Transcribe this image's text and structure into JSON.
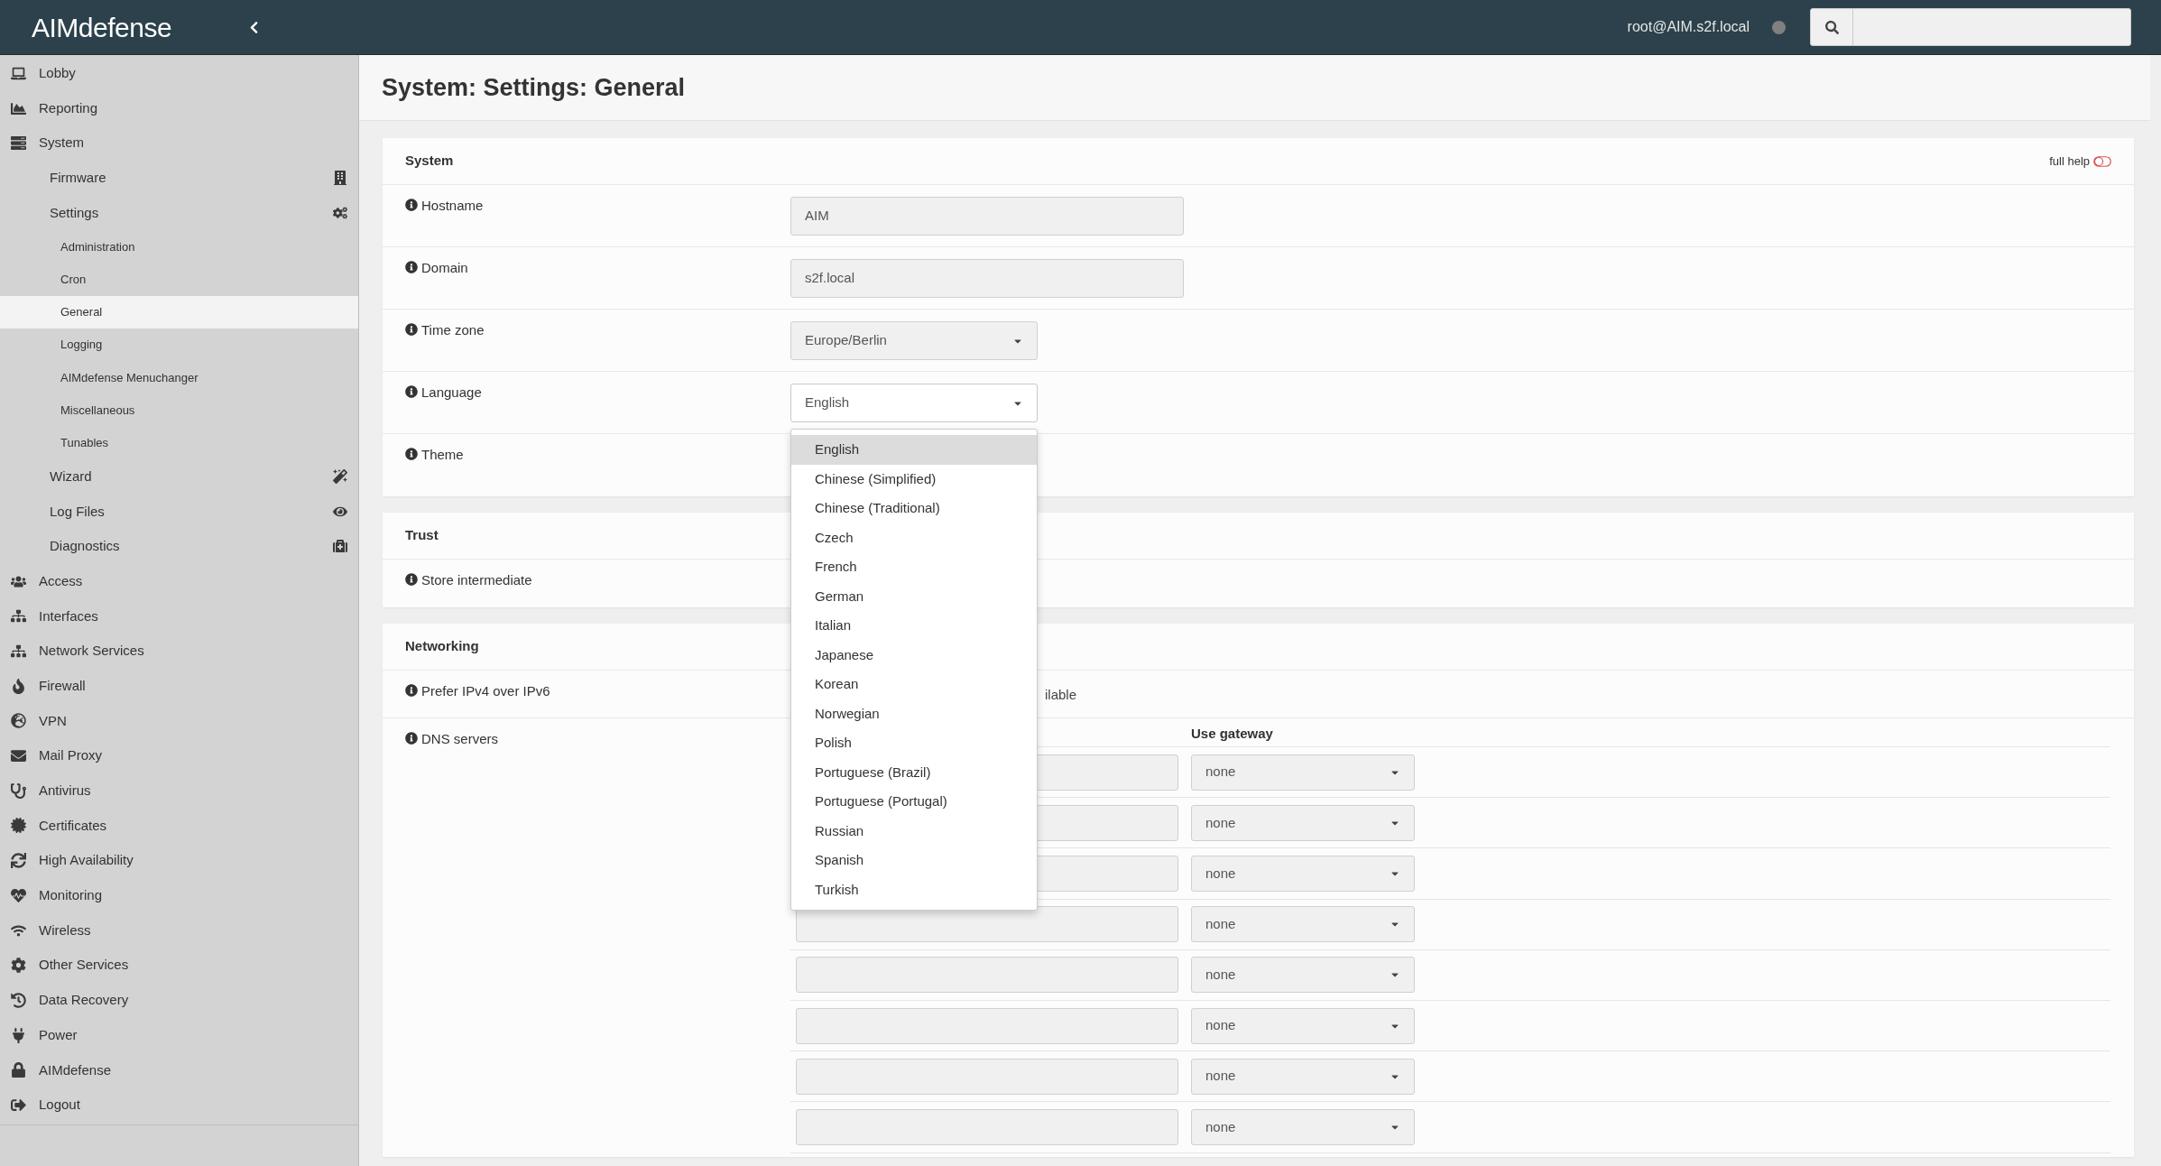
{
  "topbar": {
    "logo": "AIMdefense",
    "user": "root@AIM.s2f.local"
  },
  "sidebar": {
    "items": [
      {
        "label": "Lobby",
        "selected": false
      },
      {
        "label": "Reporting",
        "selected": false
      },
      {
        "label": "System",
        "selected": false,
        "children": [
          {
            "label": "Firmware",
            "selected": false
          },
          {
            "label": "Settings",
            "selected": false,
            "children": [
              {
                "label": "Administration",
                "selected": false
              },
              {
                "label": "Cron",
                "selected": false
              },
              {
                "label": "General",
                "selected": true
              },
              {
                "label": "Logging",
                "selected": false
              },
              {
                "label": "AIMdefense Menuchanger",
                "selected": false
              },
              {
                "label": "Miscellaneous",
                "selected": false
              },
              {
                "label": "Tunables",
                "selected": false
              }
            ]
          },
          {
            "label": "Wizard",
            "selected": false
          },
          {
            "label": "Log Files",
            "selected": false
          },
          {
            "label": "Diagnostics",
            "selected": false
          }
        ]
      },
      {
        "label": "Access",
        "selected": false
      },
      {
        "label": "Interfaces",
        "selected": false
      },
      {
        "label": "Network Services",
        "selected": false
      },
      {
        "label": "Firewall",
        "selected": false
      },
      {
        "label": "VPN",
        "selected": false
      },
      {
        "label": "Mail Proxy",
        "selected": false
      },
      {
        "label": "Antivirus",
        "selected": false
      },
      {
        "label": "Certificates",
        "selected": false
      },
      {
        "label": "High Availability",
        "selected": false
      },
      {
        "label": "Monitoring",
        "selected": false
      },
      {
        "label": "Wireless",
        "selected": false
      },
      {
        "label": "Other Services",
        "selected": false
      },
      {
        "label": "Data Recovery",
        "selected": false
      },
      {
        "label": "Power",
        "selected": false
      },
      {
        "label": "AIMdefense",
        "selected": false
      },
      {
        "label": "Logout",
        "selected": false
      }
    ]
  },
  "page_title": "System: Settings: General",
  "full_help": {
    "label": "full help",
    "on": false
  },
  "sections": [
    {
      "title": "System",
      "rows": [
        {
          "label": "Hostname",
          "field": {
            "kind": "text",
            "value": "AIM"
          }
        },
        {
          "label": "Domain",
          "field": {
            "kind": "text",
            "value": "s2f.local"
          }
        },
        {
          "label": "Time zone",
          "field": {
            "kind": "select",
            "value": "Europe/Berlin",
            "expanded": false
          }
        },
        {
          "label": "Language",
          "field": {
            "kind": "select",
            "value": "English",
            "expanded": true,
            "options": [
              {
                "label": "English",
                "selected": true
              },
              {
                "label": "Chinese (Simplified)",
                "selected": false
              },
              {
                "label": "Chinese (Traditional)",
                "selected": false
              },
              {
                "label": "Czech",
                "selected": false
              },
              {
                "label": "French",
                "selected": false
              },
              {
                "label": "German",
                "selected": false
              },
              {
                "label": "Italian",
                "selected": false
              },
              {
                "label": "Japanese",
                "selected": false
              },
              {
                "label": "Korean",
                "selected": false
              },
              {
                "label": "Norwegian",
                "selected": false
              },
              {
                "label": "Polish",
                "selected": false
              },
              {
                "label": "Portuguese (Brazil)",
                "selected": false
              },
              {
                "label": "Portuguese (Portugal)",
                "selected": false
              },
              {
                "label": "Russian",
                "selected": false
              },
              {
                "label": "Spanish",
                "selected": false
              },
              {
                "label": "Turkish",
                "selected": false
              }
            ]
          }
        },
        {
          "label": "Theme"
        }
      ]
    },
    {
      "title": "Trust",
      "rows": [
        {
          "label": "Store intermediate"
        }
      ]
    },
    {
      "title": "Networking",
      "rows": [
        {
          "label": "Prefer IPv4 over IPv6",
          "field": {
            "kind": "note",
            "text": "ilable"
          }
        },
        {
          "label": "DNS servers",
          "field": {
            "kind": "dns",
            "gateway_header": "Use gateway",
            "rows": [
              {
                "gateway": "none"
              },
              {
                "gateway": "none"
              },
              {
                "gateway": "none"
              },
              {
                "gateway": "none"
              },
              {
                "gateway": "none"
              },
              {
                "gateway": "none"
              },
              {
                "gateway": "none"
              },
              {
                "gateway": "none"
              }
            ]
          }
        }
      ]
    }
  ]
}
